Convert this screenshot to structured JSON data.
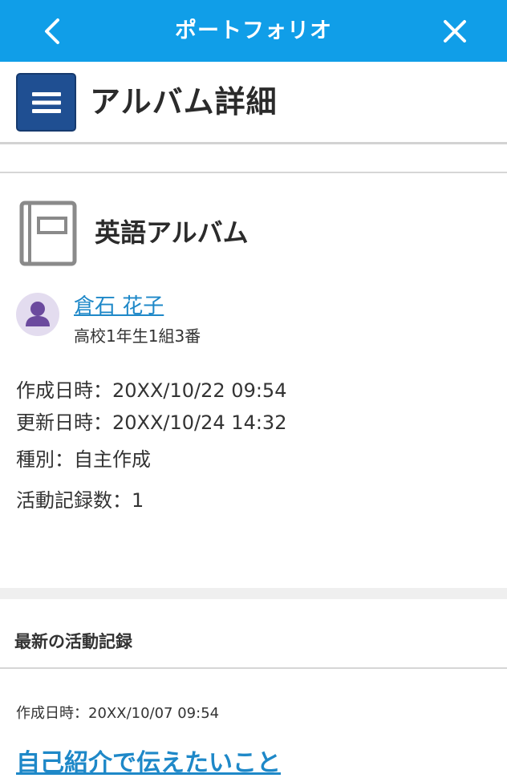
{
  "appbar": {
    "title": "ポートフォリオ",
    "back_icon": "chevron-left-icon",
    "close_icon": "close-icon",
    "background": "#109ee8"
  },
  "header": {
    "page_title": "アルバム詳細",
    "menu_icon": "hamburger-menu-icon",
    "menu_color": "#1f4f92"
  },
  "album": {
    "icon": "album-icon",
    "name": "英語アルバム",
    "owner": {
      "name": "倉石 花子",
      "grade": "高校1年生1組3番",
      "avatar_icon": "person-icon"
    },
    "created": "作成日時：20XX/10/22 09:54",
    "updated": "更新日時：20XX/10/24 14:32",
    "type": "種別：自主作成",
    "record_count": "活動記録数：1"
  },
  "latest": {
    "section_title": "最新の活動記録",
    "record": {
      "created": "作成日時：20XX/10/07 09:54",
      "title": "自己紹介で伝えたいこと"
    }
  },
  "colors": {
    "link": "#1e88c8",
    "accent": "#109ee8"
  }
}
